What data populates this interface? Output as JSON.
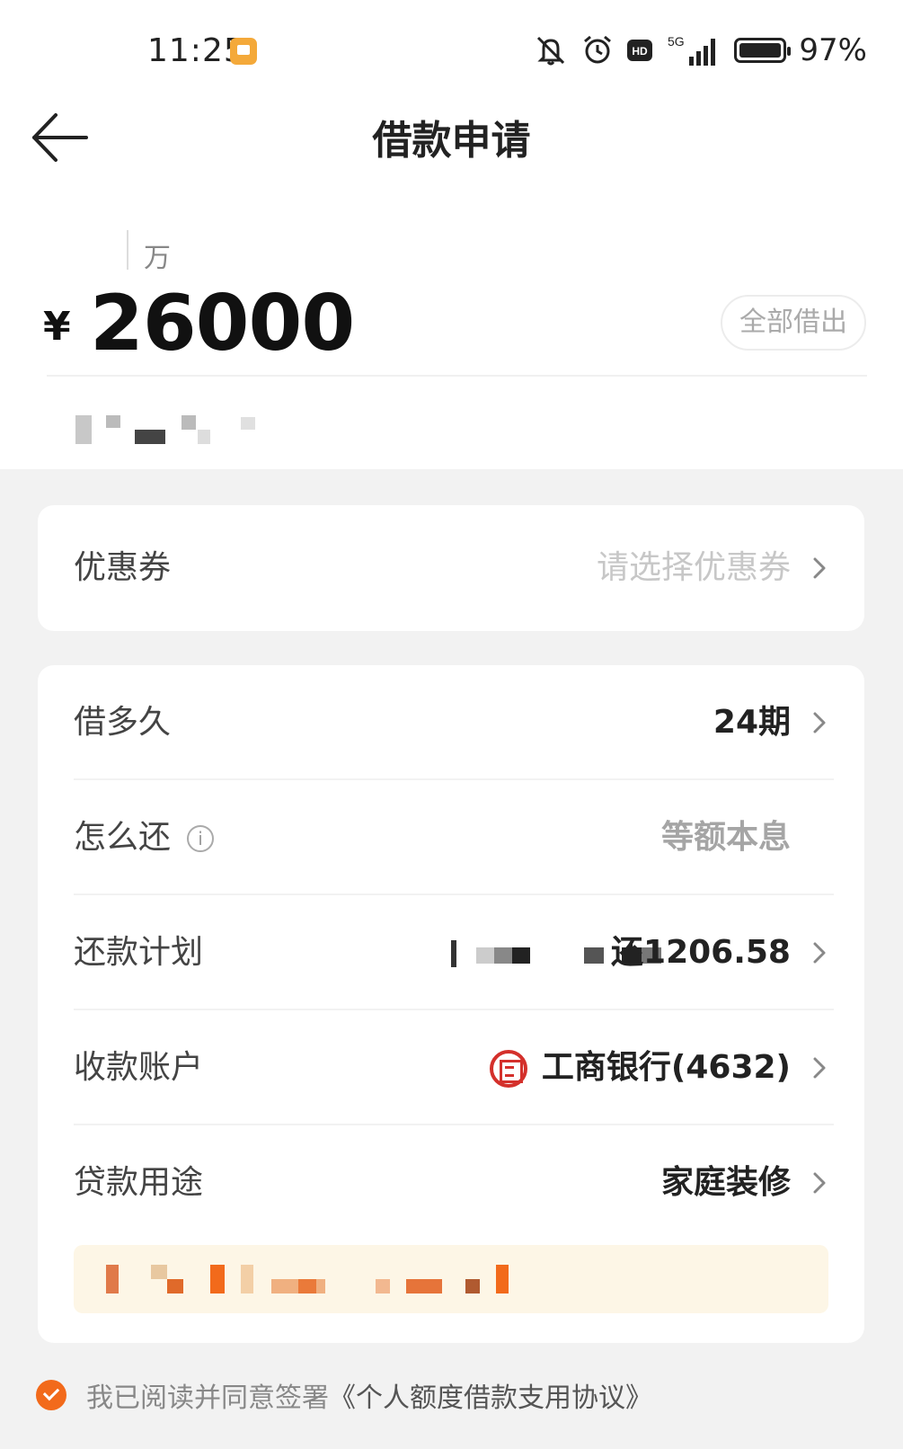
{
  "status_bar": {
    "time": "11:25",
    "network": "5G",
    "battery": "97%"
  },
  "nav": {
    "title": "借款申请"
  },
  "amount": {
    "unit": "万",
    "currency_symbol": "¥",
    "value": "26000",
    "borrow_all_label": "全部借出"
  },
  "coupon": {
    "label": "优惠券",
    "placeholder": "请选择优惠券"
  },
  "loan_details": {
    "term": {
      "label": "借多久",
      "value": "24期"
    },
    "repayment_method": {
      "label": "怎么还",
      "value": "等额本息"
    },
    "repayment_plan": {
      "label": "还款计划",
      "value": "还1206.58"
    },
    "account": {
      "label": "收款账户",
      "value": "工商银行(4632)"
    },
    "purpose": {
      "label": "贷款用途",
      "value": "家庭装修"
    }
  },
  "agreement": {
    "text": "我已阅读并同意签署",
    "link": "《个人额度借款支用协议》"
  },
  "colors": {
    "accent": "#f26a1b",
    "bank_red": "#d4302b",
    "background": "#f2f2f2"
  }
}
